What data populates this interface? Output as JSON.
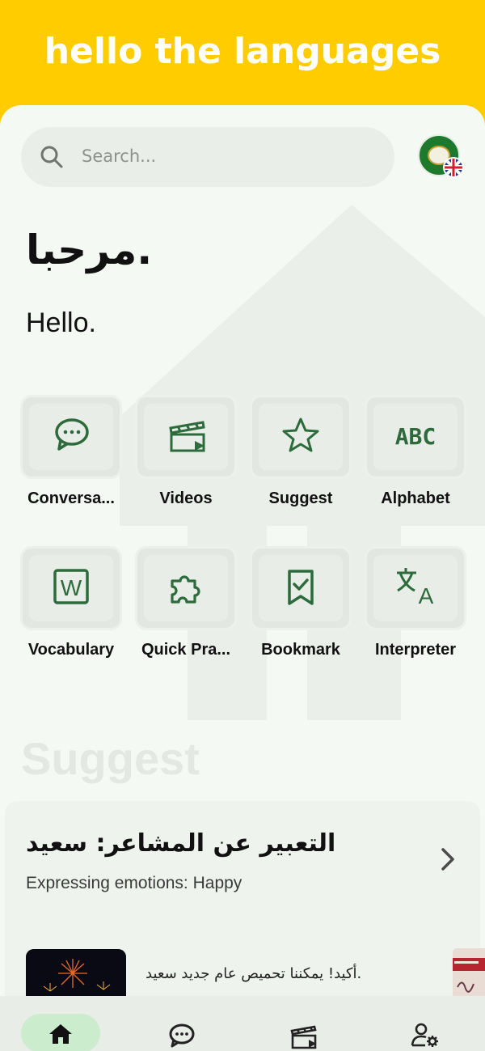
{
  "app_title": "hello the languages",
  "search": {
    "placeholder": "Search..."
  },
  "greeting": {
    "arabic": "مرحبا.",
    "english": "Hello."
  },
  "features": [
    {
      "label": "Conversa...",
      "icon": "chat-bubble-icon"
    },
    {
      "label": "Videos",
      "icon": "clapperboard-icon"
    },
    {
      "label": "Suggest",
      "icon": "star-icon"
    },
    {
      "label": "Alphabet",
      "icon": "abc-icon"
    },
    {
      "label": "Vocabulary",
      "icon": "word-doc-icon"
    },
    {
      "label": "Quick Pra...",
      "icon": "puzzle-icon"
    },
    {
      "label": "Bookmark",
      "icon": "bookmark-check-icon"
    },
    {
      "label": "Interpreter",
      "icon": "translate-icon"
    }
  ],
  "suggest": {
    "heading": "Suggest",
    "card": {
      "title_ar": "التعبير عن المشاعر: سعيد",
      "subtitle_en": "Expressing emotions: Happy"
    },
    "item": {
      "text_ar": "أكيد! يمكننا تحميص عام جديد سعيد."
    }
  },
  "bottom_nav": [
    {
      "name": "home",
      "icon": "home-icon",
      "active": true
    },
    {
      "name": "chat",
      "icon": "chat-icon",
      "active": false
    },
    {
      "name": "videos",
      "icon": "clapperboard-icon",
      "active": false
    },
    {
      "name": "profile-settings",
      "icon": "user-settings-icon",
      "active": false
    }
  ],
  "colors": {
    "header": "#ffcc00",
    "accent": "#2e6b3c",
    "nav_active": "#cbeccd"
  }
}
